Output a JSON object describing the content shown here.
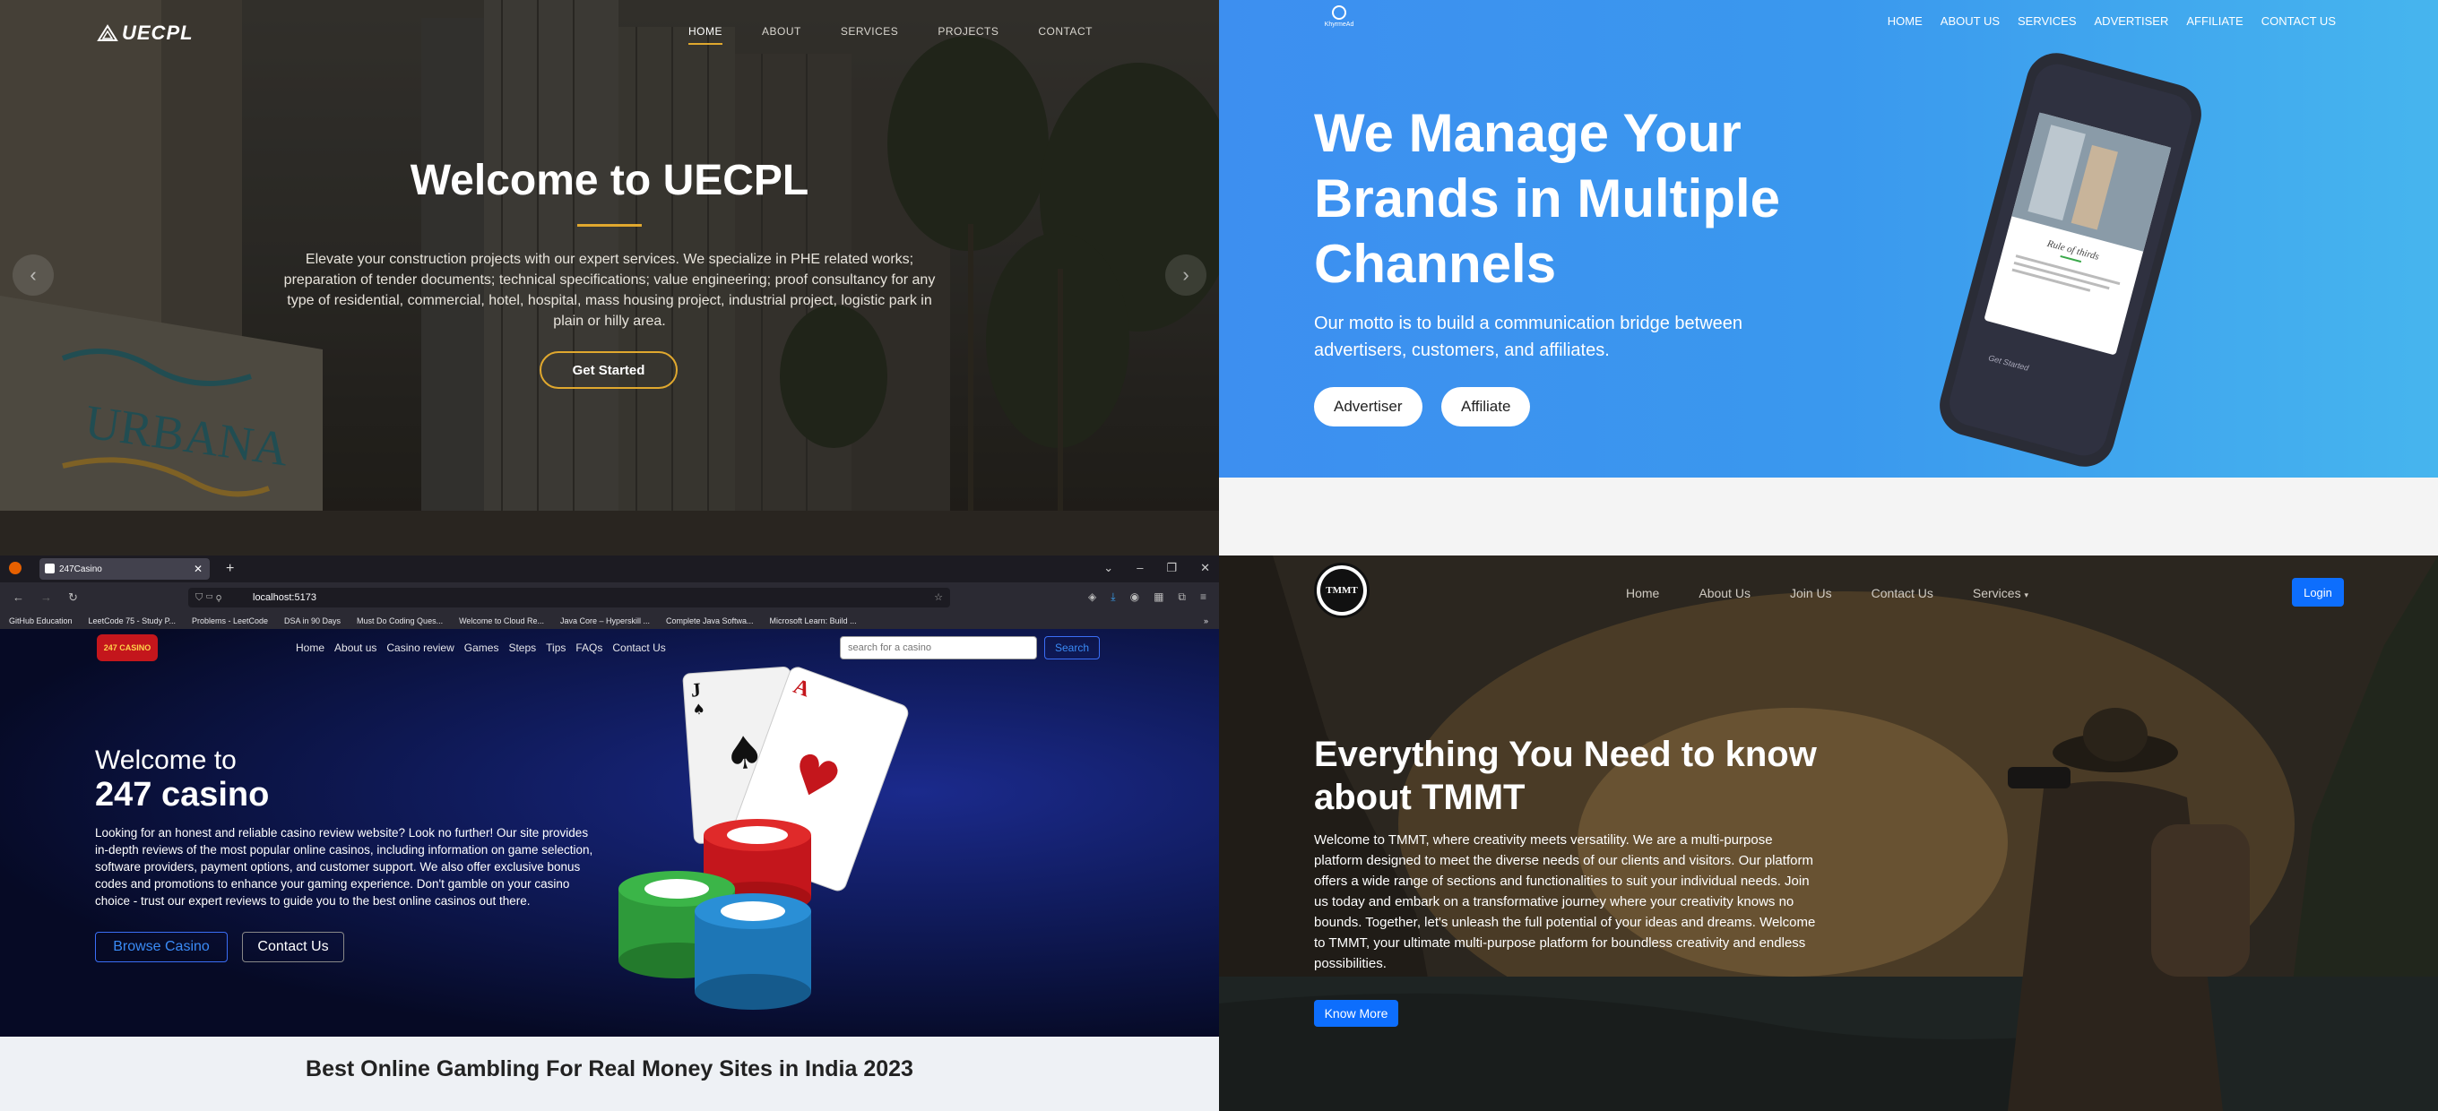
{
  "uecpl": {
    "logo": "UECPL",
    "nav": [
      "HOME",
      "ABOUT",
      "SERVICES",
      "PROJECTS",
      "CONTACT"
    ],
    "title": "Welcome to UECPL",
    "description": "Elevate your construction projects with our expert services. We specialize in PHE related works; preparation of tender documents; technical specifications; value engineering; proof consultancy for any type of residential, commercial, hotel, hospital, mass housing project, industrial project, logistic park in plain or hilly area.",
    "cta": "Get Started",
    "sign_text": "URBANA",
    "accent_color": "#e0a82e"
  },
  "khyrme": {
    "logo_text": "KhyrmeAd",
    "nav": [
      "HOME",
      "ABOUT US",
      "SERVICES",
      "ADVERTISER",
      "AFFILIATE",
      "CONTACT US"
    ],
    "title": "We Manage Your Brands in Multiple Channels",
    "subtitle": "Our motto is to build a communication bridge between advertisers, customers, and affiliates.",
    "buttons": [
      "Advertiser",
      "Affiliate"
    ],
    "phone_card_title": "Rule of thirds",
    "phone_card_text": "The rule of thirds states that an image is most pleasing when its subjects or regions are...",
    "phone_cta": "Get Started",
    "hero_color": "#3d8ff0"
  },
  "casino": {
    "browser": {
      "tab_title": "247Casino",
      "url": "localhost:5173",
      "bookmarks": [
        "GitHub Education",
        "LeetCode 75 - Study P...",
        "Problems - LeetCode",
        "DSA in 90 Days",
        "Must Do Coding Ques...",
        "Welcome to Cloud Re...",
        "Java Core – Hyperskill ...",
        "Complete Java Softwa...",
        "Microsoft Learn: Build ..."
      ]
    },
    "logo": "247 CASINO",
    "nav": [
      "Home",
      "About us",
      "Casino review",
      "Games",
      "Steps",
      "Tips",
      "FAQs",
      "Contact Us"
    ],
    "search_placeholder": "search for a casino",
    "search_button": "Search",
    "welcome": "Welcome to",
    "brand": "247 casino",
    "description": "Looking for an honest and reliable casino review website? Look no further! Our site provides in-depth reviews of the most popular online casinos, including information on game selection, software providers, payment options, and customer support. We also offer exclusive bonus codes and promotions to enhance your gaming experience. Don't gamble on your casino choice - trust our expert reviews to guide you to the best online casinos out there.",
    "btn_browse": "Browse Casino",
    "btn_contact": "Contact Us",
    "section_title": "Best Online Gambling For Real Money Sites in India 2023",
    "card_rank": "A",
    "card_rank_2": "J"
  },
  "tmmt": {
    "logo": "TMMT",
    "nav": [
      "Home",
      "About Us",
      "Join Us",
      "Contact Us",
      "Services"
    ],
    "login": "Login",
    "title": "Everything You Need to know about TMMT",
    "description": "Welcome to TMMT, where creativity meets versatility. We are a multi-purpose platform designed to meet the diverse needs of our clients and visitors. Our platform offers a wide range of sections and functionalities to suit your individual needs. Join us today and embark on a transformative journey where your creativity knows no bounds. Together, let's unleash the full potential of your ideas and dreams. Welcome to TMMT, your ultimate multi-purpose platform for boundless creativity and endless possibilities.",
    "cta": "Know More",
    "primary_color": "#0d6efd"
  }
}
